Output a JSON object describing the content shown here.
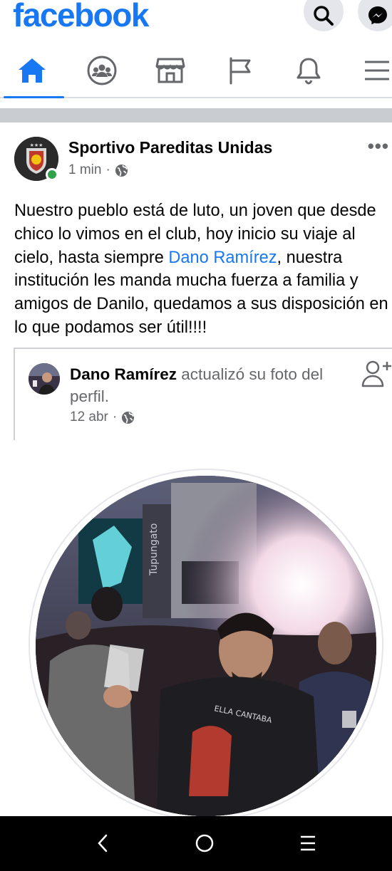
{
  "app": {
    "logo_text": "facebook",
    "brand_color": "#1877f2"
  },
  "header": {
    "search_icon": "search-icon",
    "messenger_icon": "messenger-icon"
  },
  "nav_tabs": [
    {
      "name": "home",
      "icon": "home-icon",
      "active": true
    },
    {
      "name": "groups",
      "icon": "groups-icon",
      "active": false
    },
    {
      "name": "marketplace",
      "icon": "marketplace-icon",
      "active": false
    },
    {
      "name": "pages",
      "icon": "flag-icon",
      "active": false
    },
    {
      "name": "notifications",
      "icon": "bell-icon",
      "active": false
    },
    {
      "name": "menu",
      "icon": "hamburger-icon",
      "active": false
    }
  ],
  "post": {
    "author": "Sportivo Pareditas Unidas",
    "time": "1 min",
    "separator": "·",
    "audience_icon": "globe-icon",
    "more_label": "•••",
    "text_before_mention": "Nuestro pueblo está de luto, un joven que desde chico lo vimos en el club, hoy inicio su viaje al cielo, hasta siempre ",
    "mention": "Dano Ramírez",
    "text_after_mention": ", nuestra institución les manda mucha fuerza a familia y amigos de Danilo, quedamos a sus disposición en lo que podamos ser útil!!!!"
  },
  "shared_post": {
    "author": "Dano Ramírez",
    "action": " actualizó su foto del perfil.",
    "date": "12 abr",
    "separator": "·",
    "audience_icon": "globe-icon",
    "add_friend_icon": "add-friend-icon"
  },
  "system_nav": {
    "back_icon": "back-icon",
    "home_icon": "home-circle-icon",
    "recents_icon": "recents-icon"
  }
}
